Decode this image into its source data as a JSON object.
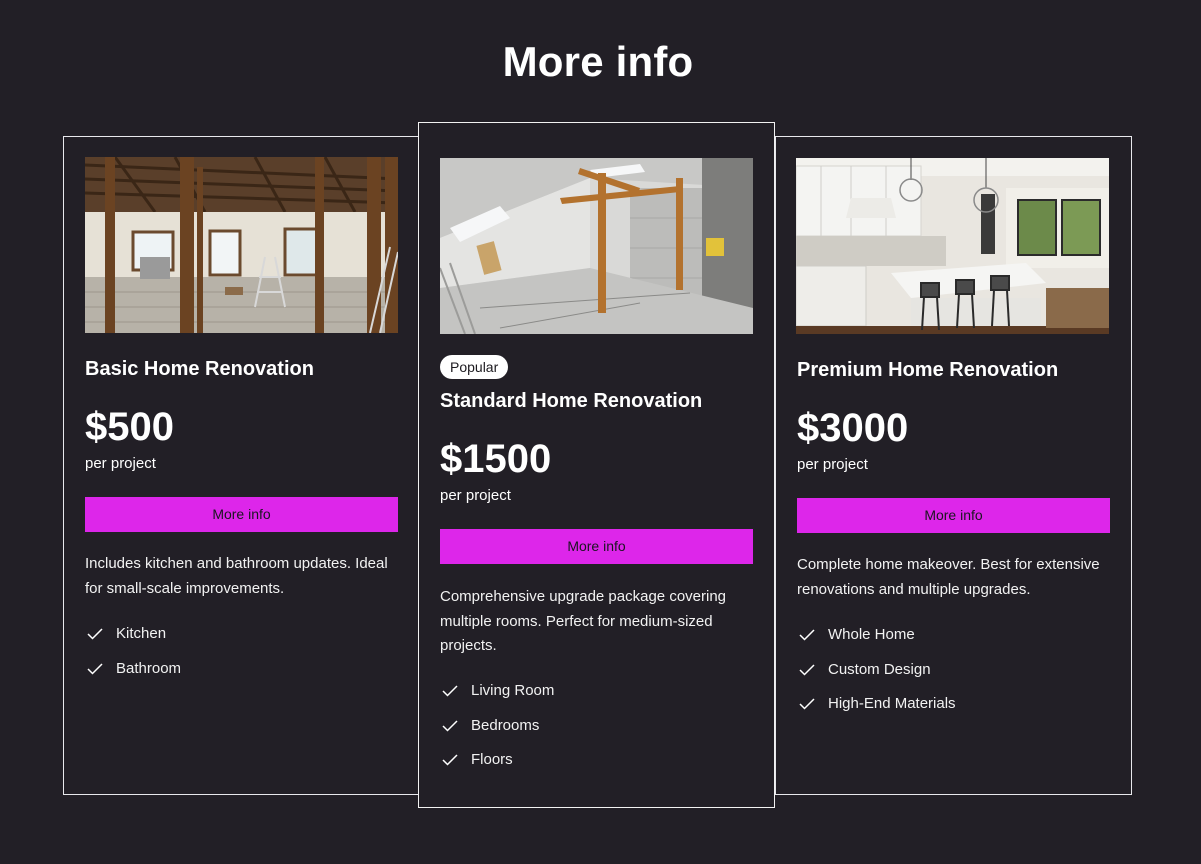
{
  "page": {
    "title": "More info"
  },
  "colors": {
    "background": "#221f26",
    "accent": "#dd26ea",
    "text": "#ffffff",
    "border": "#e8e8ec"
  },
  "plans": [
    {
      "name": "Basic Home Renovation",
      "badge": "",
      "price": "$500",
      "unit": "per project",
      "cta": "More info",
      "description": "Includes kitchen and bathroom updates. Ideal for small-scale improvements.",
      "image": "gutted-house-interior-photo",
      "features": [
        "Kitchen",
        "Bathroom"
      ]
    },
    {
      "name": "Standard Home Renovation",
      "badge": "Popular",
      "price": "$1500",
      "unit": "per project",
      "cta": "More info",
      "description": "Comprehensive upgrade package covering multiple rooms. Perfect for medium-sized projects.",
      "image": "attic-construction-photo",
      "features": [
        "Living Room",
        "Bedrooms",
        "Floors"
      ]
    },
    {
      "name": "Premium Home Renovation",
      "badge": "",
      "price": "$3000",
      "unit": "per project",
      "cta": "More info",
      "description": "Complete home makeover. Best for extensive renovations and multiple upgrades.",
      "image": "luxury-kitchen-photo",
      "features": [
        "Whole Home",
        "Custom Design",
        "High-End Materials"
      ]
    }
  ],
  "icons": {
    "feature_check": "check-icon"
  }
}
